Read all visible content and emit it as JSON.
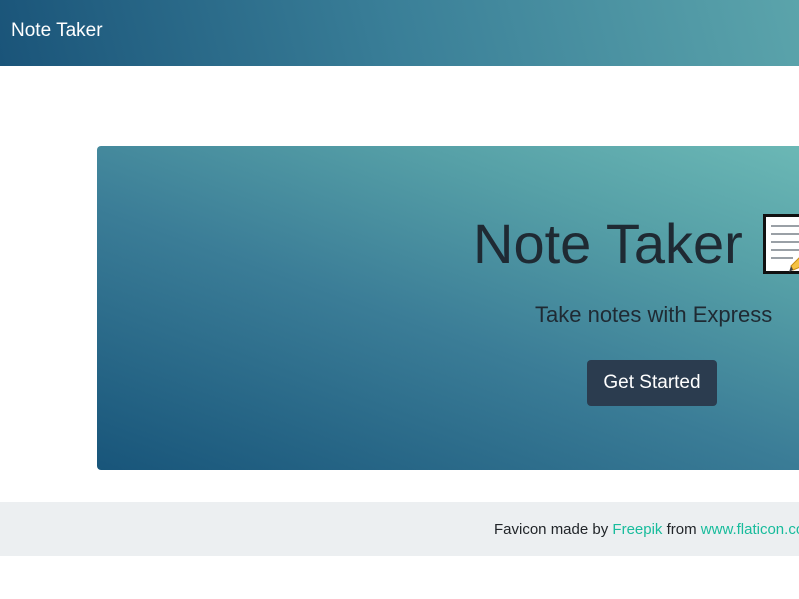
{
  "navbar": {
    "brand": "Note Taker"
  },
  "hero": {
    "title": "Note Taker",
    "subtitle": "Take notes with Express",
    "button_label": "Get Started",
    "icon": "note-pencil-icon"
  },
  "footer": {
    "prefix": "Favicon made by",
    "author_link": "Freepik",
    "middle": "from",
    "site_link": "www.flaticon.com"
  },
  "colors": {
    "navbar_gradient_start": "#1a5479",
    "navbar_gradient_end": "#5ba4ab",
    "hero_gradient_start": "#18557a",
    "hero_gradient_end": "#6cb9b6",
    "button_bg": "#2b3c4f",
    "link": "#18bc9c",
    "footer_bg": "#eceff1",
    "text_dark": "#1f2a33"
  }
}
